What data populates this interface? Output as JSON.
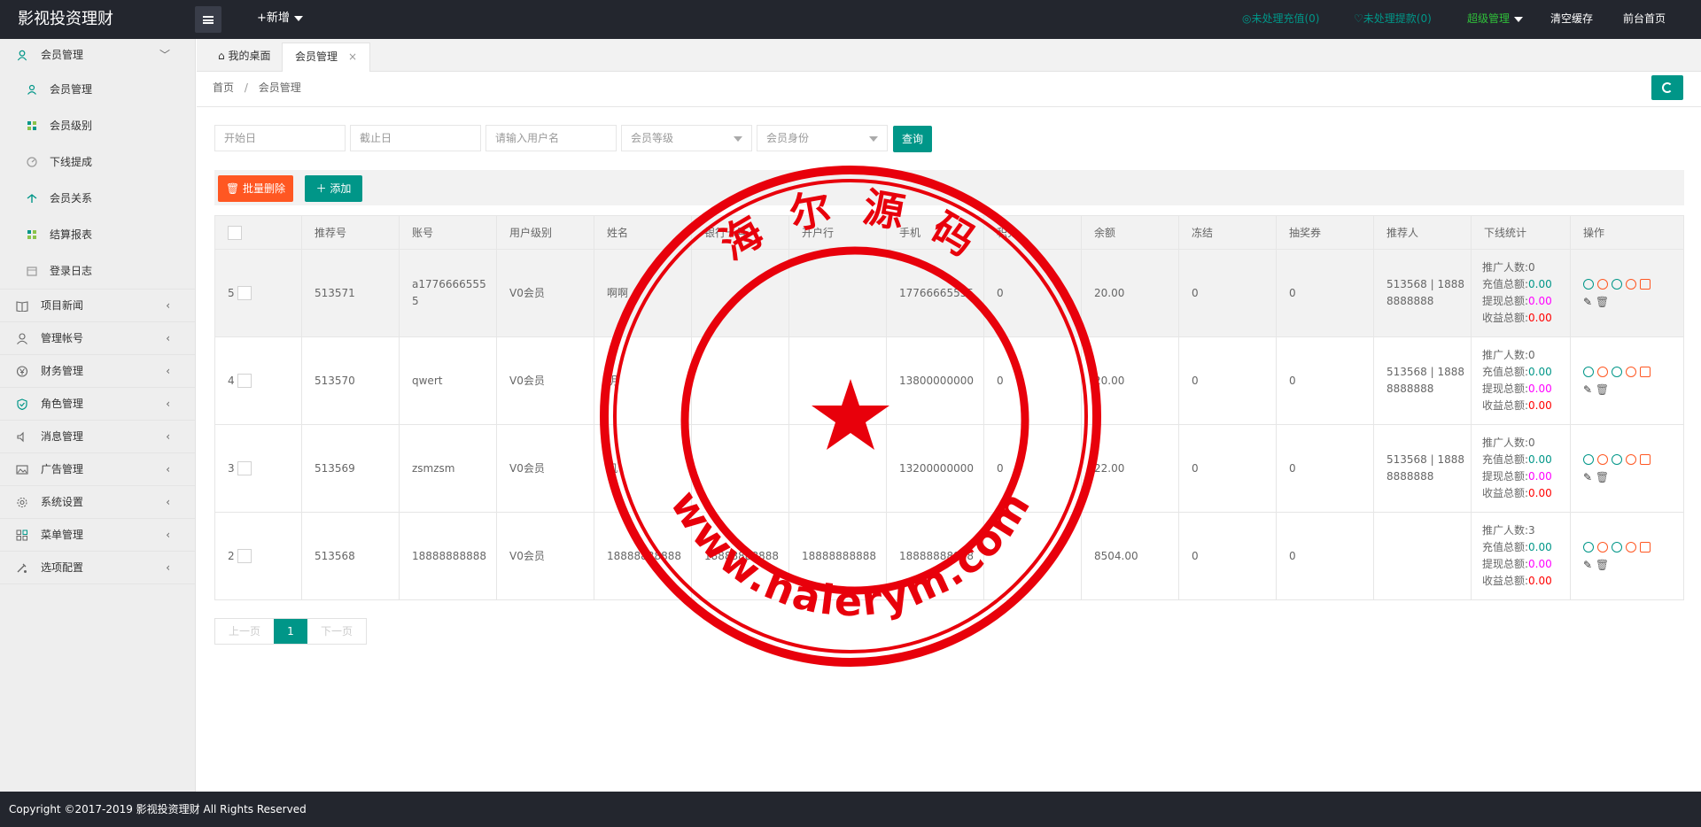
{
  "header": {
    "logo": "影视投资理财",
    "new_label": "+新增",
    "pending_recharge": "未处理充值(0)",
    "pending_withdraw": "未处理提款(0)",
    "super_admin": "超级管理",
    "clear_cache": "清空缓存",
    "front_home": "前台首页"
  },
  "sidebar": {
    "group_member": "会员管理",
    "subs": [
      "会员管理",
      "会员级别",
      "下线提成",
      "会员关系",
      "结算报表",
      "登录日志"
    ],
    "groups": [
      "项目新闻",
      "管理帐号",
      "财务管理",
      "角色管理",
      "消息管理",
      "广告管理",
      "系统设置",
      "菜单管理",
      "选项配置"
    ]
  },
  "tabs": [
    "我的桌面",
    "会员管理"
  ],
  "breadcrumb": {
    "home": "首页",
    "sep": "/",
    "current": "会员管理"
  },
  "search": {
    "start_placeholder": "开始日",
    "end_placeholder": "截止日",
    "username_placeholder": "请输入用户名",
    "level_placeholder": "会员等级",
    "identity_placeholder": "会员身份",
    "query_label": "查询"
  },
  "toolbar": {
    "batch_delete": "批量删除",
    "add": "添加"
  },
  "table": {
    "headers": [
      "",
      "推荐号",
      "账号",
      "用户级别",
      "姓名",
      "银行卡号",
      "开户行",
      "手机",
      "积分",
      "余额",
      "冻结",
      "抽奖券",
      "推荐人",
      "下线统计",
      "操作"
    ],
    "rows": [
      {
        "idx": "5",
        "ref": "513571",
        "acct": "a17766665555",
        "level": "V0会员",
        "name": "啊啊",
        "card": "",
        "bank": "",
        "phone": "17766665555",
        "points": "0",
        "balance": "20.00",
        "frozen": "0",
        "tickets": "0",
        "referrer": "513568 | 18888888888",
        "count": "推广人数:0",
        "recharge": "0.00",
        "withdraw": "0.00",
        "income": "0.00"
      },
      {
        "idx": "4",
        "ref": "513570",
        "acct": "qwert",
        "level": "V0会员",
        "name": "明",
        "card": "",
        "bank": "",
        "phone": "13800000000",
        "points": "0",
        "balance": "20.00",
        "frozen": "0",
        "tickets": "0",
        "referrer": "513568 | 18888888888",
        "count": "推广人数:0",
        "recharge": "0.00",
        "withdraw": "0.00",
        "income": "0.00"
      },
      {
        "idx": "3",
        "ref": "513569",
        "acct": "zsmzsm",
        "level": "V0会员",
        "name": "机",
        "card": "",
        "bank": "",
        "phone": "13200000000",
        "points": "0",
        "balance": "22.00",
        "frozen": "0",
        "tickets": "0",
        "referrer": "513568 | 18888888888",
        "count": "推广人数:0",
        "recharge": "0.00",
        "withdraw": "0.00",
        "income": "0.00"
      },
      {
        "idx": "2",
        "ref": "513568",
        "acct": "18888888888",
        "level": "V0会员",
        "name": "18888888888",
        "card": "18888888888",
        "bank": "18888888888",
        "phone": "18888888888",
        "points": "",
        "balance": "8504.00",
        "frozen": "0",
        "tickets": "0",
        "referrer": "",
        "count": "推广人数:3",
        "recharge": "0.00",
        "withdraw": "0.00",
        "income": "0.00"
      }
    ],
    "recharge_label": "充值总额:",
    "withdraw_label": "提现总额:",
    "income_label": "收益总额:"
  },
  "pager": {
    "prev": "上一页",
    "current": "1",
    "next": "下一页"
  },
  "footer": "Copyright ©2017-2019 影视投资理财 All Rights Reserved",
  "stamp": {
    "top_text": "海 尔 源 码",
    "bottom_text": "www.haierym.com"
  },
  "colors": {
    "primary": "#009688",
    "danger": "#ff5722",
    "header_bg": "#23262e",
    "stamp": "#e8000b"
  }
}
